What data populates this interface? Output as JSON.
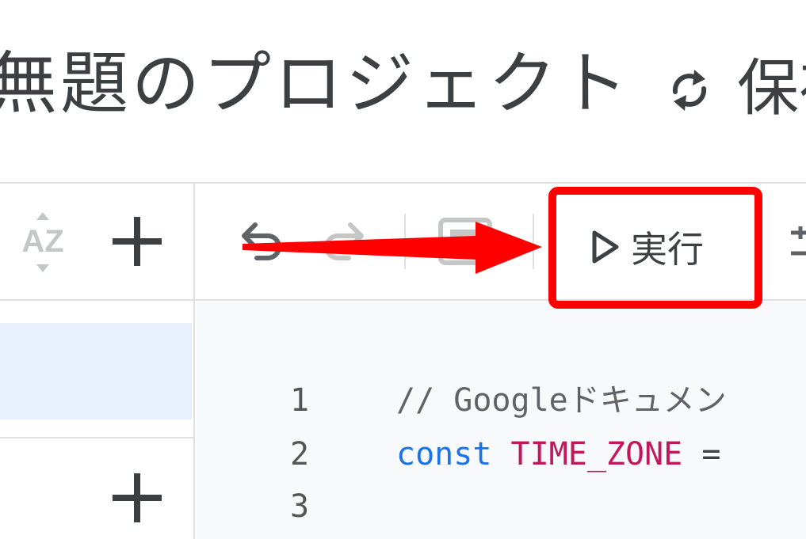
{
  "header": {
    "project_title": "無題のプロジェクト",
    "save_status": "保存"
  },
  "sidebar": {
    "sort_icon_label": "AZ"
  },
  "toolbar": {
    "run_label": "実行"
  },
  "annotation": {
    "highlight_color": "#ff0000",
    "arrow_color": "#ff0000"
  },
  "editor": {
    "lines": [
      {
        "number": "1",
        "tokens": [
          {
            "text": "// Googleドキュメン",
            "kind": "comment"
          }
        ]
      },
      {
        "number": "2",
        "tokens": [
          {
            "text": "const",
            "kind": "keyword"
          },
          {
            "text": " ",
            "kind": "op"
          },
          {
            "text": "TIME_ZONE",
            "kind": "const"
          },
          {
            "text": " =",
            "kind": "op"
          }
        ]
      },
      {
        "number": "3",
        "tokens": []
      }
    ]
  },
  "colors": {
    "accent_blue": "#1a73e8",
    "selected_bg": "#e8f0fe",
    "editor_bg": "#f8f9fa",
    "text": "#3c4043",
    "icon_grey": "#5f6368",
    "disabled_grey": "#c4c7c5",
    "constant_pink": "#c2185b"
  }
}
